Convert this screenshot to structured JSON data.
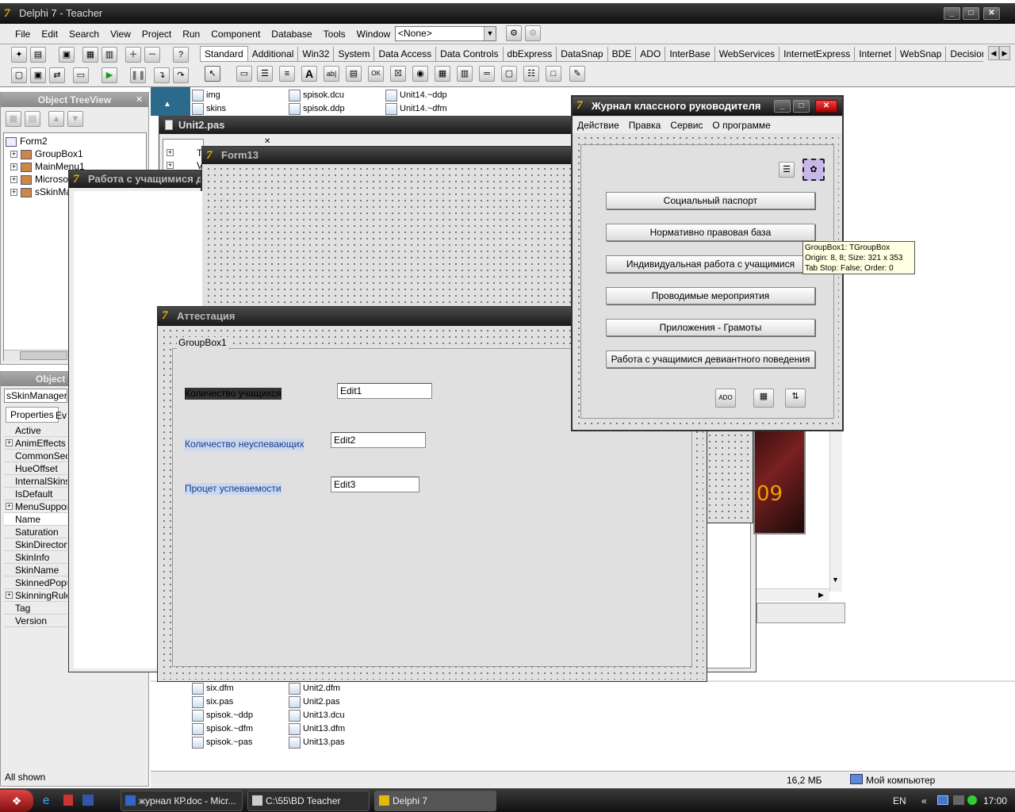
{
  "ide": {
    "title": "Delphi 7 - Teacher",
    "menu": [
      "File",
      "Edit",
      "Search",
      "View",
      "Project",
      "Run",
      "Component",
      "Database",
      "Tools",
      "Window",
      "Help"
    ],
    "combo_value": "<None>",
    "palette_tabs": [
      "Standard",
      "Additional",
      "Win32",
      "System",
      "Data Access",
      "Data Controls",
      "dbExpress",
      "DataSnap",
      "BDE",
      "ADO",
      "InterBase",
      "WebServices",
      "InternetExpress",
      "Internet",
      "WebSnap",
      "Decision Cube"
    ]
  },
  "treeview": {
    "title": "Object TreeView",
    "items": [
      "Form2",
      "GroupBox1",
      "MainMenu1",
      "Microso",
      "sSkinMa"
    ]
  },
  "inspector": {
    "title": "Object I",
    "object": "sSkinManager1",
    "tabs": [
      "Properties",
      "Ev"
    ],
    "props": [
      "Active",
      "AnimEffects",
      "CommonSecti",
      "HueOffset",
      "InternalSkins",
      "IsDefault",
      "MenuSupport",
      "Name",
      "Saturation",
      "SkinDirectory",
      "SkinInfo",
      "SkinName",
      "SkinnedPopup",
      "SkinningRules",
      "Tag",
      "Version"
    ],
    "status": "All shown"
  },
  "explorer": {
    "top_col1": [
      "img",
      "skins"
    ],
    "top_col2": [
      "spisok.dcu",
      "spisok.ddp"
    ],
    "top_col3": [
      "Unit14.~ddp",
      "Unit14.~dfm"
    ],
    "bot_col1": [
      "six.dfm",
      "six.pas",
      "spisok.~ddp",
      "spisok.~dfm",
      "spisok.~pas"
    ],
    "bot_col2": [
      "Unit2.dfm",
      "Unit2.pas",
      "Unit13.dcu",
      "Unit13.dfm",
      "Unit13.pas"
    ],
    "status_size": "16,2 МБ",
    "status_location": "Мой компьютер"
  },
  "unit2": {
    "title": "Unit2.pas",
    "tree_items": [
      "T",
      "V"
    ]
  },
  "form13": {
    "title": "Form13"
  },
  "rabota": {
    "title": "Работа с учащимися девиантного поведения"
  },
  "photo": {
    "text": "09"
  },
  "attest": {
    "title": "Аттестация",
    "groupbox": "GroupBox1",
    "labels": [
      "Количество учащихся",
      "Количество неуспевающих",
      "Процет успеваемости"
    ],
    "edits": [
      "Edit1",
      "Edit2",
      "Edit3"
    ]
  },
  "journal": {
    "title": "Журнал классного руководителя",
    "menu": [
      "Действие",
      "Правка",
      "Сервис",
      "О программе"
    ],
    "buttons": [
      "Социальный паспорт",
      "Нормативно правовая база",
      "Индивидуальная работа с учащимися",
      "Проводимые мероприятия",
      "Приложения - Грамоты",
      "Работа с учащимися девиантного поведения"
    ]
  },
  "tooltip": {
    "line1": "GroupBox1: TGroupBox",
    "line2": "Origin: 8, 8; Size: 321 x 353",
    "line3": "Tab Stop: False; Order: 0"
  },
  "taskbar": {
    "tasks": [
      "журнал КР.doc - Micr...",
      "C:\\55\\BD Teacher",
      "Delphi 7"
    ],
    "lang": "EN",
    "clock": "17:00"
  },
  "colors": {
    "title_dark": "#1a1a1a",
    "taskbar": "#1f1f1f",
    "selection": "#c8d8f0",
    "tooltip": "#ffffe1"
  }
}
